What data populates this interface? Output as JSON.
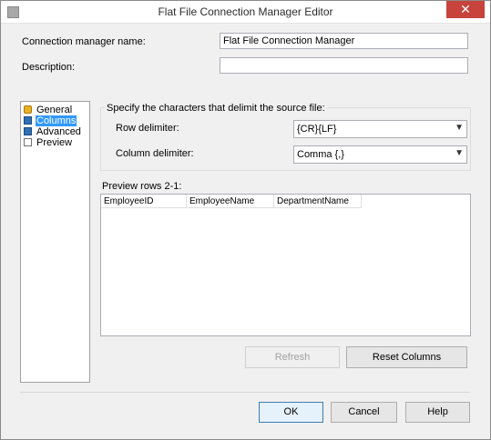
{
  "window": {
    "title": "Flat File Connection Manager Editor",
    "close_glyph": "✕"
  },
  "form": {
    "name_label": "Connection manager name:",
    "name_value": "Flat File Connection Manager",
    "description_label": "Description:",
    "description_value": ""
  },
  "nav": {
    "items": [
      {
        "label": "General",
        "icon": "general-icon"
      },
      {
        "label": "Columns",
        "icon": "columns-icon",
        "selected": true
      },
      {
        "label": "Advanced",
        "icon": "advanced-icon"
      },
      {
        "label": "Preview",
        "icon": "preview-icon"
      }
    ]
  },
  "delimiters": {
    "group_label": "Specify the characters that delimit the source file:",
    "row_label": "Row delimiter:",
    "row_value": "{CR}{LF}",
    "column_label": "Column delimiter:",
    "column_value": "Comma {,}"
  },
  "preview": {
    "label": "Preview rows 2-1:",
    "columns": [
      "EmployeeID",
      "EmployeeName",
      "DepartmentName"
    ]
  },
  "buttons": {
    "refresh": "Refresh",
    "reset_columns": "Reset Columns",
    "ok": "OK",
    "cancel": "Cancel",
    "help": "Help"
  },
  "colors": {
    "selection": "#3399ff",
    "close": "#c7433b"
  }
}
